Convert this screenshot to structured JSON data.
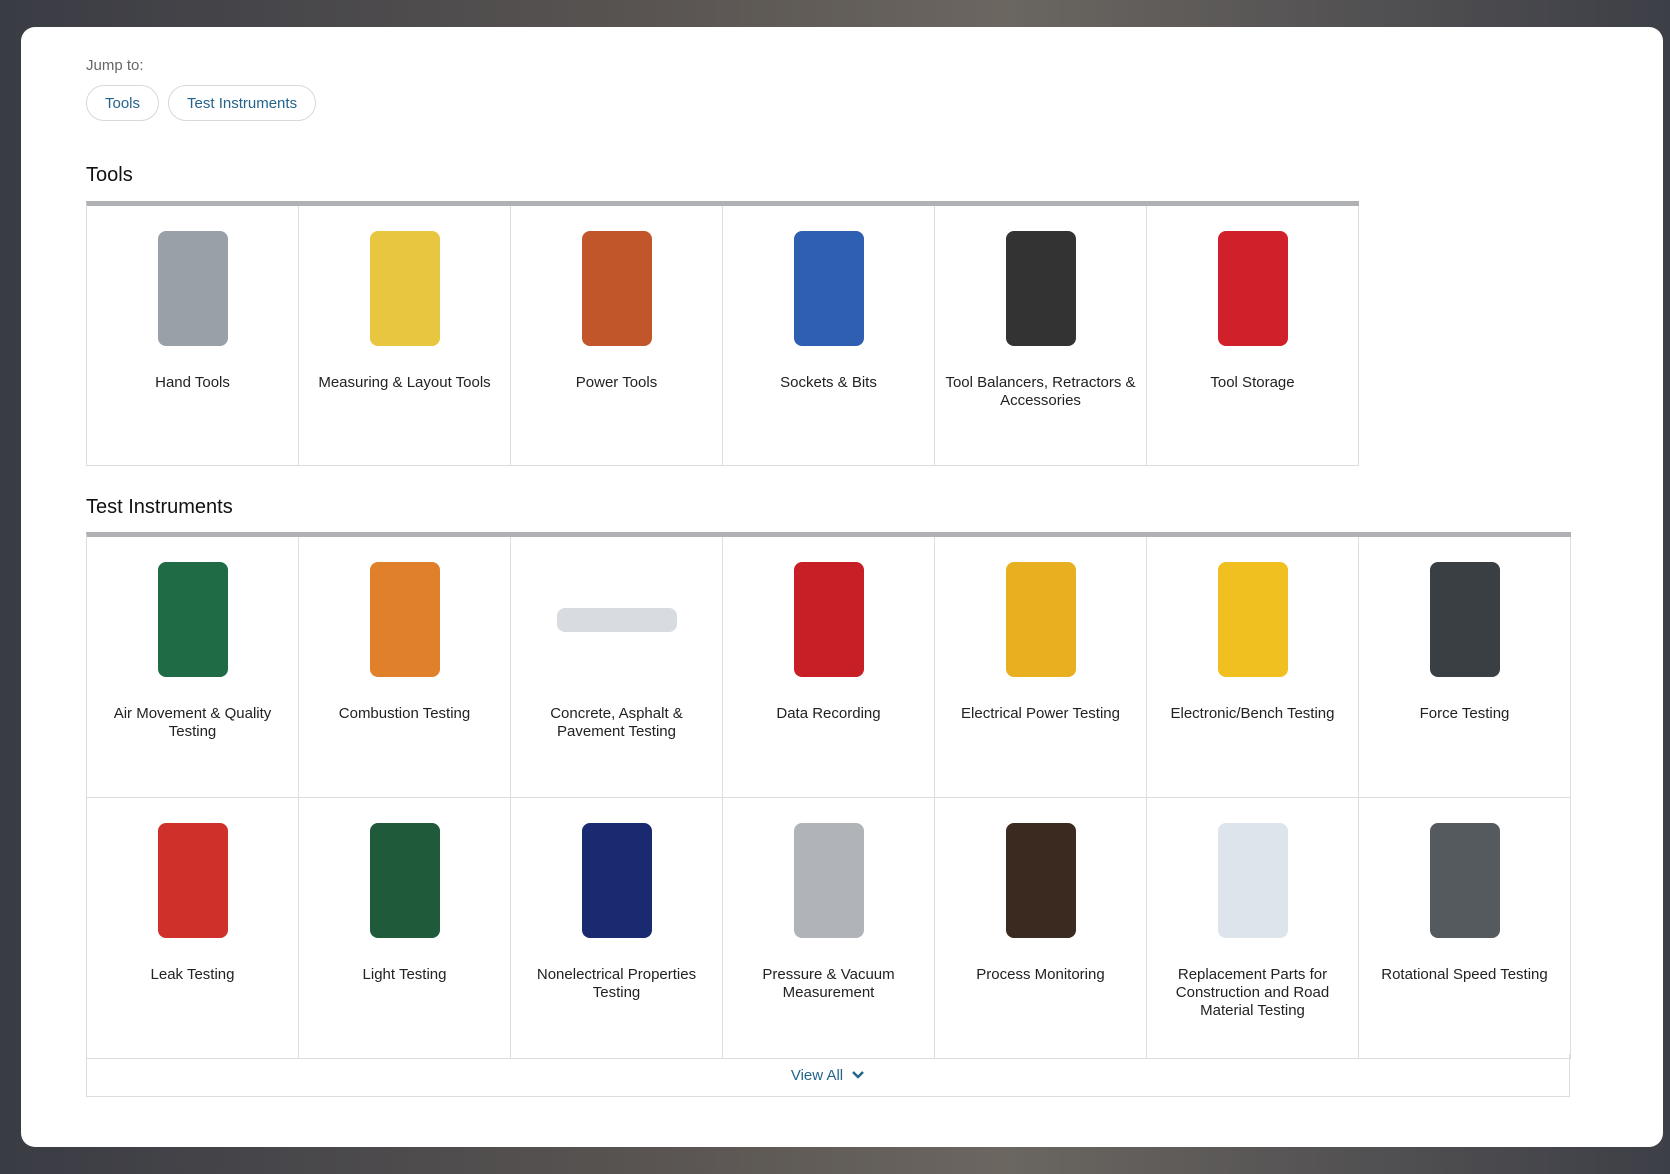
{
  "jump_to": {
    "label": "Jump to:",
    "links": [
      "Tools",
      "Test Instruments"
    ]
  },
  "sections": [
    {
      "title": "Tools",
      "items": [
        {
          "label": "Hand Tools",
          "color": "#9aa0a8",
          "icon": "pliers"
        },
        {
          "label": "Measuring & Layout Tools",
          "color": "#e8c640",
          "icon": "tape-measure"
        },
        {
          "label": "Power Tools",
          "color": "#c0562a",
          "icon": "drill"
        },
        {
          "label": "Sockets & Bits",
          "color": "#2f5fb0",
          "icon": "socket-set"
        },
        {
          "label": "Tool Balancers, Retractors & Accessories",
          "color": "#333333",
          "icon": "balancer"
        },
        {
          "label": "Tool Storage",
          "color": "#d0202a",
          "icon": "tool-chest"
        }
      ]
    },
    {
      "title": "Test Instruments",
      "items": [
        {
          "label": "Air Movement & Quality Testing",
          "color": "#1f6b45",
          "icon": "anemometer"
        },
        {
          "label": "Combustion Testing",
          "color": "#e0802a",
          "icon": "combustion-analyzer"
        },
        {
          "label": "Concrete, Asphalt & Pavement Testing",
          "color": "#d8dce0",
          "icon": "gauge-strip"
        },
        {
          "label": "Data Recording",
          "color": "#c81e26",
          "icon": "datalogger"
        },
        {
          "label": "Electrical Power Testing",
          "color": "#e8b020",
          "icon": "multimeter"
        },
        {
          "label": "Electronic/Bench Testing",
          "color": "#f0c020",
          "icon": "oscilloscope"
        },
        {
          "label": "Force Testing",
          "color": "#3a3f44",
          "icon": "force-gauge"
        },
        {
          "label": "Leak Testing",
          "color": "#d0302a",
          "icon": "leak-detector"
        },
        {
          "label": "Light Testing",
          "color": "#1f5a3a",
          "icon": "light-meter"
        },
        {
          "label": "Nonelectrical Properties Testing",
          "color": "#1a2a70",
          "icon": "radiation-meter"
        },
        {
          "label": "Pressure & Vacuum Measurement",
          "color": "#b0b4b8",
          "icon": "pressure-gauge"
        },
        {
          "label": "Process Monitoring",
          "color": "#3a2a20",
          "icon": "panel-meter"
        },
        {
          "label": "Replacement Parts for Construction and Road Material Testing",
          "color": "#dde4ec",
          "icon": "parts-box"
        },
        {
          "label": "Rotational Speed Testing",
          "color": "#555a5e",
          "icon": "tachometer"
        }
      ]
    }
  ],
  "view_all": "View All"
}
